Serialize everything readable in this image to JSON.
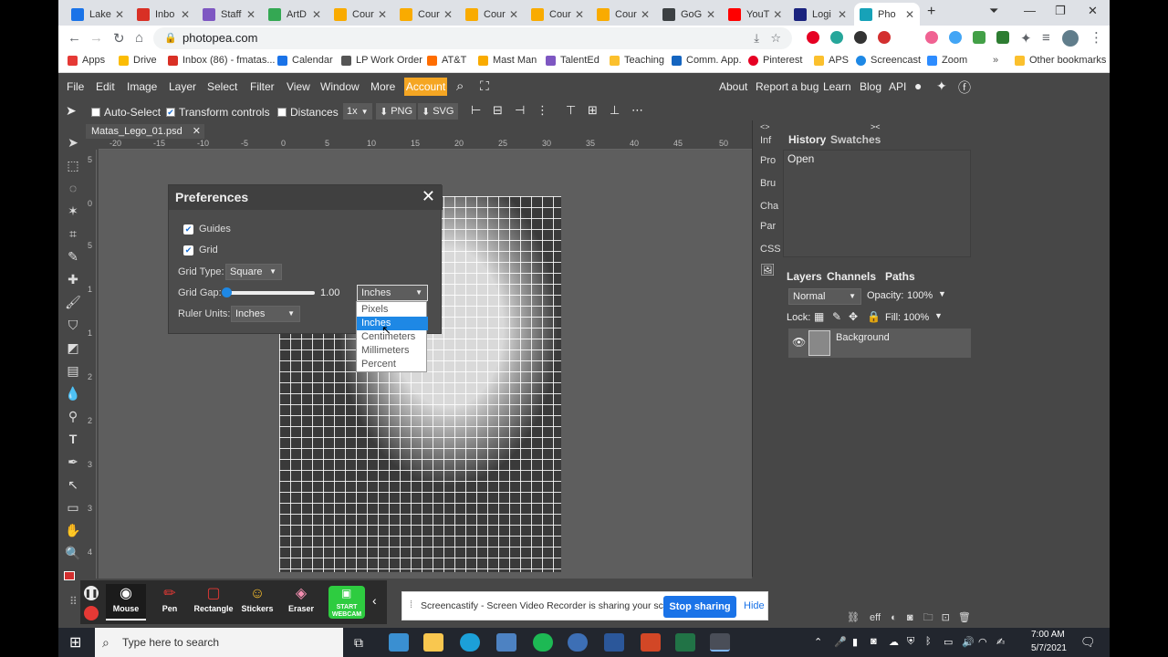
{
  "browser": {
    "tabs": [
      {
        "label": "Lake",
        "color": "#1a73e8"
      },
      {
        "label": "Inbo",
        "color": "#d93025"
      },
      {
        "label": "Staff",
        "color": "#7e57c2"
      },
      {
        "label": "ArtD",
        "color": "#34a853"
      },
      {
        "label": "Cour",
        "color": "#f9ab00"
      },
      {
        "label": "Cour",
        "color": "#f9ab00"
      },
      {
        "label": "Cour",
        "color": "#f9ab00"
      },
      {
        "label": "Cour",
        "color": "#f9ab00"
      },
      {
        "label": "Cour",
        "color": "#f9ab00"
      },
      {
        "label": "GoG",
        "color": "#3c4043"
      },
      {
        "label": "YouT",
        "color": "#ff0000"
      },
      {
        "label": "Logi",
        "color": "#1a237e"
      },
      {
        "label": "Pho",
        "color": "#17a2b8"
      }
    ],
    "url": "photopea.com",
    "bookmarks": [
      {
        "label": "Apps",
        "color": "#e53935"
      },
      {
        "label": "Drive",
        "color": "#fbbc04"
      },
      {
        "label": "Inbox (86) - fmatas...",
        "color": "#d93025"
      },
      {
        "label": "Calendar",
        "color": "#1a73e8"
      },
      {
        "label": "LP Work Order",
        "color": "#555555"
      },
      {
        "label": "AT&T",
        "color": "#ff6d00"
      },
      {
        "label": "Mast Man",
        "color": "#f9ab00"
      },
      {
        "label": "TalentEd",
        "color": "#7e57c2"
      },
      {
        "label": "Teaching",
        "color": "#fbc02d"
      },
      {
        "label": "Comm. App.",
        "color": "#1565c0"
      },
      {
        "label": "Pinterest",
        "color": "#e60023"
      },
      {
        "label": "APS",
        "color": "#fbc02d"
      },
      {
        "label": "Screencast",
        "color": "#1e88e5"
      },
      {
        "label": "Zoom",
        "color": "#2d8cff"
      },
      {
        "label": "Other bookmarks",
        "color": "#fbc02d"
      }
    ]
  },
  "photopea": {
    "menu": [
      "File",
      "Edit",
      "Image",
      "Layer",
      "Select",
      "Filter",
      "View",
      "Window",
      "More"
    ],
    "account": "Account",
    "right_menu": [
      "About",
      "Report a bug",
      "Learn",
      "Blog",
      "API"
    ],
    "options": {
      "auto_select": "Auto-Select",
      "transform_controls": "Transform controls",
      "distances": "Distances",
      "zoom": "1x",
      "png": "PNG",
      "svg": "SVG"
    },
    "doc_tab": "Matas_Lego_01.psd",
    "ruler_h": [
      "-20",
      "-15",
      "-10",
      "-5",
      "0",
      "5",
      "10",
      "15",
      "20",
      "25",
      "30",
      "35",
      "40",
      "45",
      "50"
    ],
    "ruler_v": [
      "5",
      "0",
      "5",
      "1",
      "1",
      "2",
      "2",
      "3",
      "3",
      "4"
    ],
    "mini_panel": [
      "Inf",
      "Pro",
      "Bru",
      "Cha",
      "Par",
      "CSS"
    ],
    "history": {
      "tabs": [
        "History",
        "Swatches"
      ],
      "entries": [
        "Open"
      ]
    },
    "layers": {
      "tabs": [
        "Layers",
        "Channels",
        "Paths"
      ],
      "blend": "Normal",
      "opacity_label": "Opacity:",
      "opacity": "100%",
      "lock_label": "Lock:",
      "fill_label": "Fill:",
      "fill": "100%",
      "layer_name": "Background"
    },
    "preferences": {
      "title": "Preferences",
      "guides": "Guides",
      "grid": "Grid",
      "grid_type_label": "Grid Type:",
      "grid_type": "Square",
      "grid_gap_label": "Grid Gap:",
      "grid_gap_value": "1.00",
      "grid_gap_unit": "Inches",
      "ruler_units_label": "Ruler Units:",
      "ruler_units": "Inches",
      "unit_options": [
        "Pixels",
        "Inches",
        "Centimeters",
        "Millimeters",
        "Percent"
      ],
      "selected_option": "Inches"
    }
  },
  "screencastify": {
    "tools": [
      "Mouse",
      "Pen",
      "Rectangle",
      "Stickers",
      "Eraser"
    ],
    "webcam": "START WEBCAM",
    "share_message": "Screencastify - Screen Video Recorder is sharing your screen.",
    "stop_label": "Stop sharing",
    "hide_label": "Hide"
  },
  "taskbar": {
    "search_placeholder": "Type here to search",
    "time": "7:00 AM",
    "date": "5/7/2021"
  }
}
